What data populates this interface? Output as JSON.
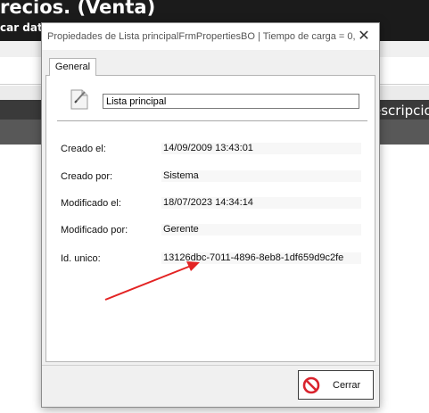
{
  "background": {
    "title": "recios. (Venta)",
    "subtitle": "car datos",
    "column_label": "escripcio"
  },
  "dialog": {
    "title": "Propiedades de Lista principalFrmPropertiesBO | Tiempo de carga = 0,...",
    "close_glyph": "✕",
    "tabs": [
      {
        "label": "General"
      }
    ],
    "name_value": "Lista principal",
    "fields": [
      {
        "label": "Creado el:",
        "value": "14/09/2009 13:43:01"
      },
      {
        "label": "Creado por:",
        "value": "Sistema"
      },
      {
        "label": "Modificado el:",
        "value": "18/07/2023 14:34:14"
      },
      {
        "label": "Modificado por:",
        "value": "Gerente"
      },
      {
        "label": "Id. unico:",
        "value": "13126dbc-7011-4896-8eb8-1df659d9c2fe"
      }
    ],
    "close_button": {
      "label": "Cerrar",
      "icon": "no-entry-icon",
      "icon_color": "#d9232d"
    }
  },
  "annotation": {
    "arrow_color": "#e32323"
  }
}
